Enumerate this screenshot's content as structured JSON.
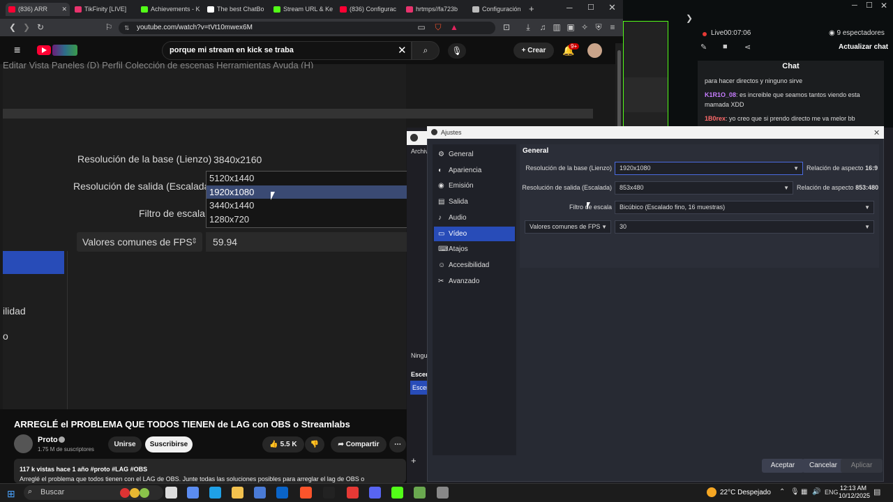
{
  "browser": {
    "tabs": [
      {
        "title": "(836) ARR",
        "color": "#ff0033",
        "active": true
      },
      {
        "title": "TikFinity [LIVE]",
        "color": "#e8336d",
        "active": false
      },
      {
        "title": "Achievements - K",
        "color": "#53fc18",
        "active": false
      },
      {
        "title": "The best ChatBo",
        "color": "#ffffff",
        "active": false
      },
      {
        "title": "Stream URL & Ke",
        "color": "#53fc18",
        "active": false
      },
      {
        "title": "(836) Configurac",
        "color": "#ff0033",
        "active": false
      },
      {
        "title": "hrtmps//fa723b",
        "color": "#e8336d",
        "active": false
      },
      {
        "title": "Configuración",
        "color": "#bbbbbb",
        "active": false
      }
    ],
    "new_tab": "+",
    "url": "youtube.com/watch?v=tVt10mwex6M"
  },
  "youtube": {
    "search_value": "porque mi stream en kick se traba",
    "create_label": "Crear",
    "notif_badge": "9+",
    "video_title": "ARREGLÉ el PROBLEMA QUE TODOS TIENEN de LAG con OBS o Streamlabs",
    "channel": "Proto",
    "subscribers": "1.75 M de suscriptores",
    "join_label": "Unirse",
    "subscribe_label": "Suscribirse",
    "likes": "5.5 K",
    "share_label": "Compartir",
    "meta": "117 k vistas  hace 1 año  #proto #LAG #OBS",
    "description": "Arreglé el problema que todos tienen con el LAG de OBS. Junte todas las soluciones posibles para arreglar el lag de OBS o",
    "video_menu": "Editar   Vista   Paneles (D)   Perfil   Colección de escenas   Herramientas   Ayuda (H)",
    "video_labels": {
      "base": "Resolución de la base (Lienzo)",
      "base_value": "3840x2160",
      "output": "Resolución de salida (Escalada)",
      "filter": "Filtro de escala",
      "fps": "Valores comunes de FPS",
      "fps_value": "59.94",
      "left1": "ilidad",
      "left2": "o"
    },
    "dropdown_options": [
      "5120x1440",
      "1920x1080",
      "3440x1440",
      "1280x720"
    ]
  },
  "kick": {
    "live_label": "Live",
    "live_time": "00:07:06",
    "viewers": "9 espectadores",
    "refresh_chat": "Actualizar chat",
    "chat_title": "Chat",
    "messages": [
      {
        "user": "",
        "text": "para hacer directos y ninguno sirve",
        "color": "#dddddd"
      },
      {
        "user": "K1R1O_08",
        "text": ": es increible que seamos tantos viendo esta mamada XDD",
        "color": "#c77dff"
      },
      {
        "user": "1B0rex",
        "text": ": yo creo que si prendo directo me va melor bb",
        "color": "#ff6b6b"
      }
    ]
  },
  "obs": {
    "bg_labels": [
      "Archiv",
      "Ningu",
      "Escen",
      "Escer"
    ],
    "window_title": "Ajustes",
    "sidebar": [
      {
        "label": "General",
        "icon": "gear-icon",
        "glyph": "⚙"
      },
      {
        "label": "Apariencia",
        "icon": "palette-icon",
        "glyph": "◐"
      },
      {
        "label": "Emisión",
        "icon": "broadcast-icon",
        "glyph": "◉"
      },
      {
        "label": "Salida",
        "icon": "output-icon",
        "glyph": "▤"
      },
      {
        "label": "Audio",
        "icon": "speaker-icon",
        "glyph": "♪"
      },
      {
        "label": "Vídeo",
        "icon": "monitor-icon",
        "glyph": "▭"
      },
      {
        "label": "Atajos",
        "icon": "keyboard-icon",
        "glyph": "⌨"
      },
      {
        "label": "Accesibilidad",
        "icon": "accessibility-icon",
        "glyph": "☺"
      },
      {
        "label": "Avanzado",
        "icon": "wrench-icon",
        "glyph": "✂"
      }
    ],
    "active_index": 5,
    "section_title": "General",
    "base_label": "Resolución de la base (Lienzo)",
    "base_value": "1920x1080",
    "base_aspect": "Relación de aspecto",
    "base_aspect_value": "16:9",
    "output_label": "Resolución de salida (Escalada)",
    "output_value": "853x480",
    "output_aspect": "Relación de aspecto",
    "output_aspect_value": "853:480",
    "filter_label": "Filtro de escala",
    "filter_value": "Bicúbico (Escalado fino, 16 muestras)",
    "fps_type": "Valores comunes de FPS",
    "fps_value": "30",
    "accept": "Aceptar",
    "cancel": "Cancelar",
    "apply": "Aplicar"
  },
  "taskbar": {
    "search": "Buscar",
    "weather": "22°C  Despejado",
    "lang": "ENG",
    "time": "12:13 AM",
    "date": "10/12/2025"
  }
}
